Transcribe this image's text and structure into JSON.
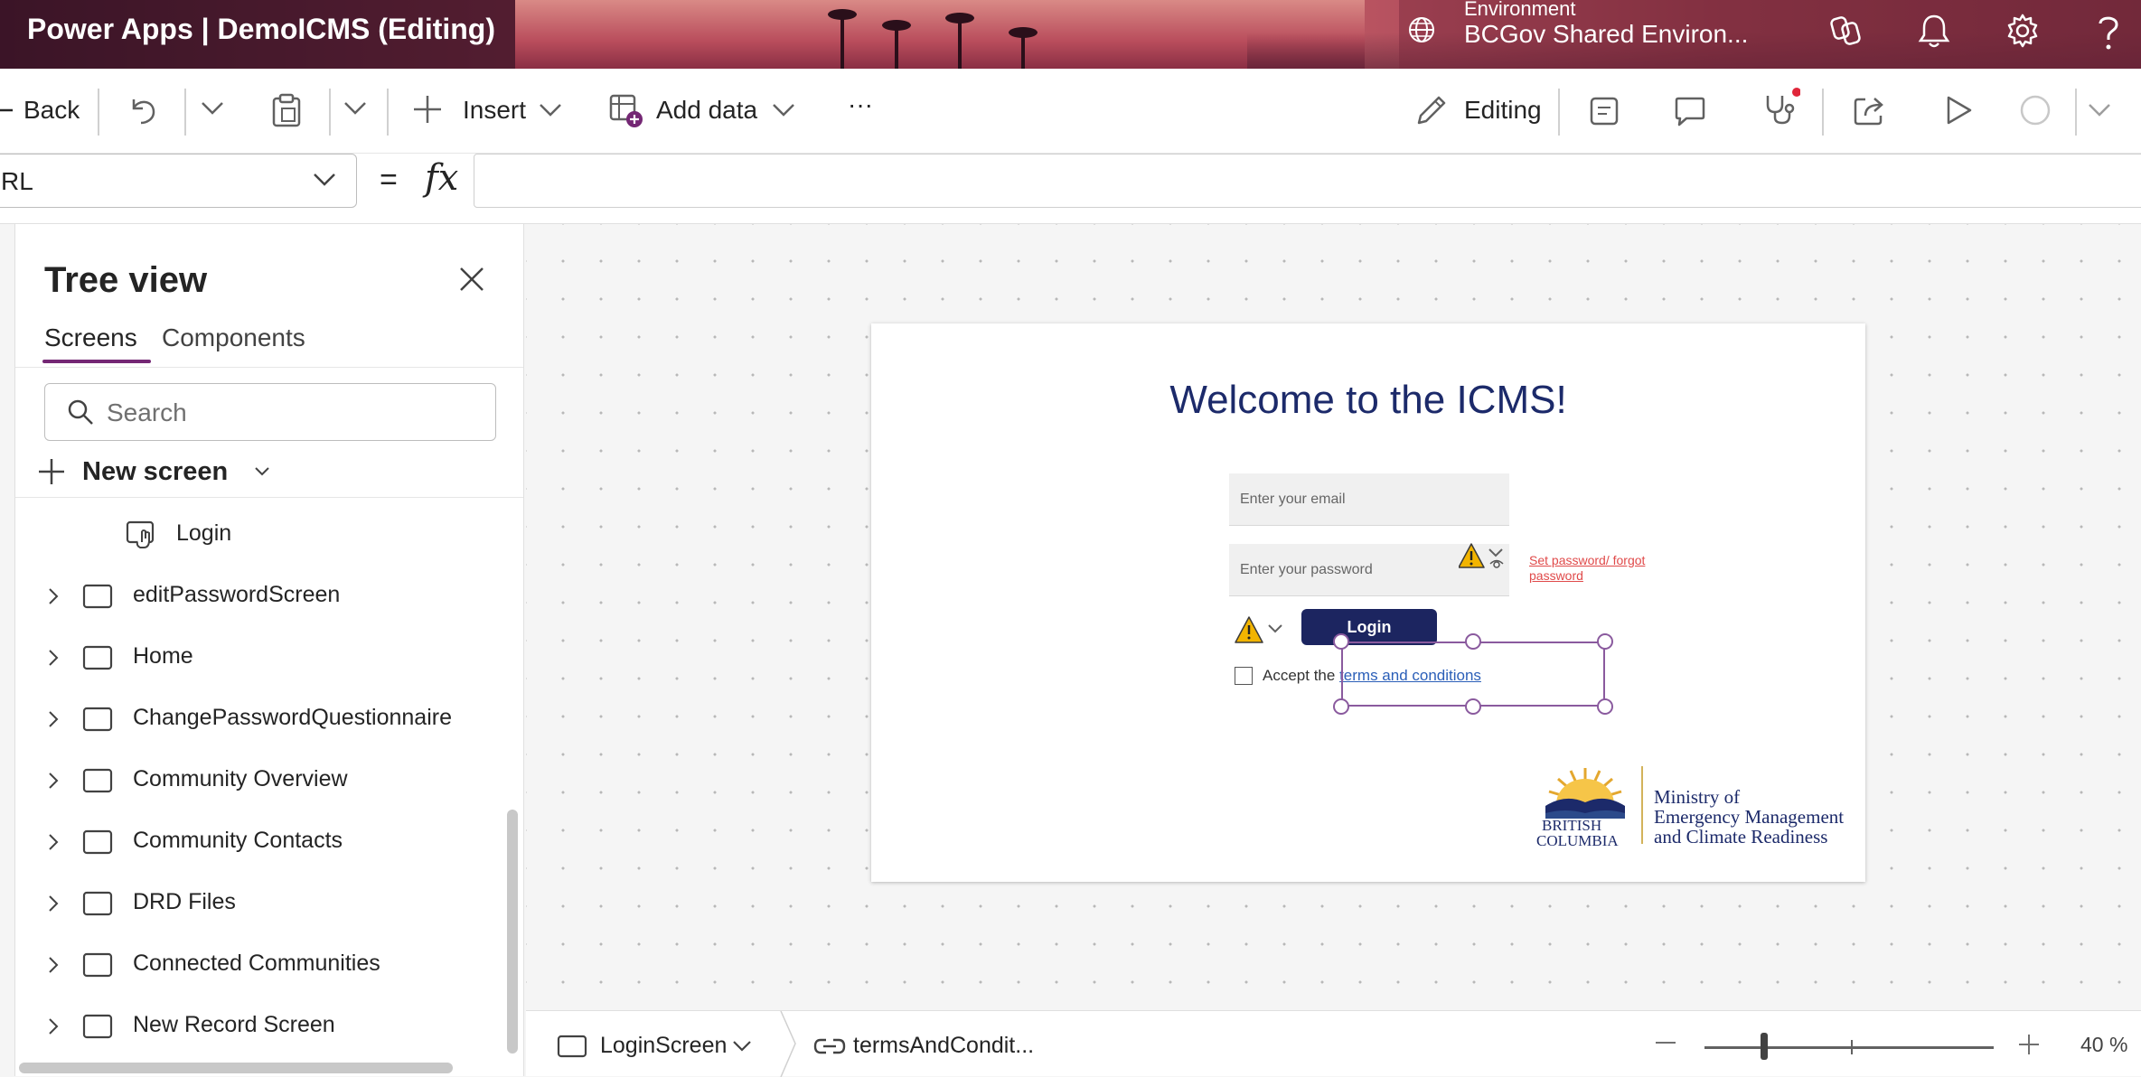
{
  "titlebar": {
    "app_title": "Power Apps  |  DemoICMS (Editing)",
    "environment_label": "Environment",
    "environment_name": "BCGov Shared Environ..."
  },
  "toolbar": {
    "back_label": "Back",
    "insert_label": "Insert",
    "add_data_label": "Add data",
    "more_label": "···",
    "editing_label": "Editing"
  },
  "formula": {
    "property": "RL",
    "equals": "=",
    "fx": "fx",
    "value": ""
  },
  "tree": {
    "title": "Tree view",
    "tabs": [
      "Screens",
      "Components"
    ],
    "search_placeholder": "Search",
    "new_screen_label": "New screen",
    "child_item": "Login",
    "screens": [
      "editPasswordScreen",
      "Home",
      "ChangePasswordQuestionnaire",
      "Community Overview",
      "Community Contacts",
      "DRD Files",
      "Connected Communities",
      "New Record Screen"
    ]
  },
  "canvas": {
    "welcome": "Welcome to the ICMS!",
    "email_placeholder": "Enter your email",
    "password_placeholder": "Enter your password",
    "set_password_link": "Set password/ forgot password",
    "login_button": "Login",
    "accept_prefix": "Accept the ",
    "terms_link": "terms and conditions",
    "logo_line1": "BRITISH",
    "logo_line2": "COLUMBIA",
    "ministry_lines": [
      "Ministry of",
      "Emergency Management",
      "and Climate Readiness"
    ]
  },
  "statusbar": {
    "screen": "LoginScreen",
    "control": "termsAndCondit...",
    "zoom": "40  %"
  },
  "colors": {
    "brand": "#742774",
    "login_button": "#1c2560",
    "heading": "#1c2a6a",
    "warning": "#f2b400",
    "link_red": "#e04a4a"
  }
}
